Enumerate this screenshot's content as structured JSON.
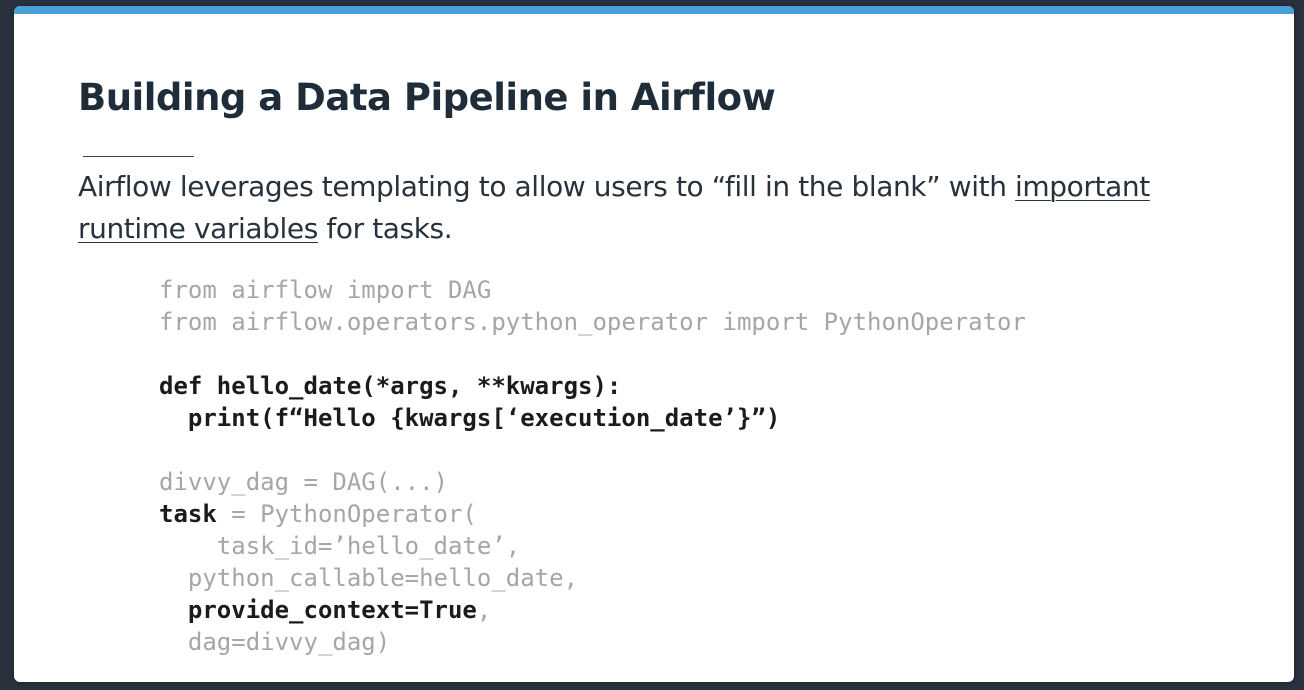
{
  "title": "Building a Data Pipeline in Airflow",
  "paragraph": {
    "before": "Airflow leverages templating to allow users to “fill in the blank” with ",
    "link": "important runtime variables",
    "after": " for tasks."
  },
  "code": {
    "l1": "from airflow import DAG",
    "l2": "from airflow.operators.python_operator import PythonOperator",
    "l3": "def hello_date(*args, **kwargs):",
    "l4": "  print(f“Hello {kwargs[‘execution_date’}”)",
    "l5": "divvy_dag = DAG(...)",
    "l6a": "task",
    "l6b": " = PythonOperator(",
    "l7": "    task_id=’hello_date’,",
    "l8": "  python_callable=hello_date,",
    "l9a": "  provide_context=True",
    "l9b": ",",
    "l10": "  dag=divvy_dag)"
  },
  "colors": {
    "accent_bar": "#4a9fd8",
    "background": "#2a3240"
  }
}
